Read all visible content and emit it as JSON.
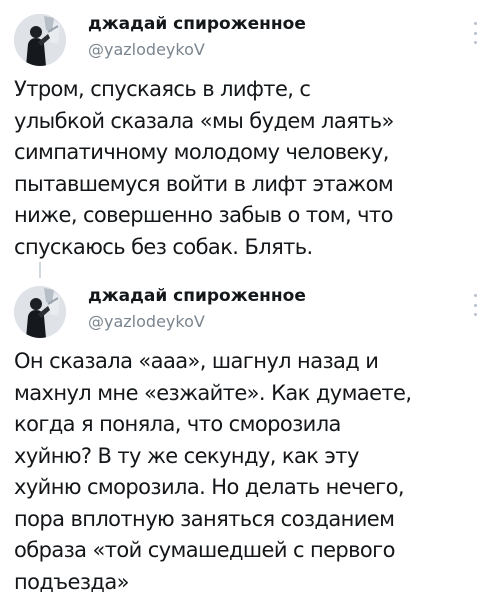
{
  "tweets": [
    {
      "author_name": "джадай спироженное",
      "author_handle": "@yazlodeykoV",
      "avatar_icon": "user-avatar",
      "more_icon": "vertical-dots-icon",
      "text": "Утром, спускаясь в лифте, с\nулыбкой сказала «мы будем лаять»\nсимпатичному молодому человеку,\nпытавшемуся войти в лифт этажом\nниже, совершенно забыв о том, что\nспускаюсь без собак. Блять."
    },
    {
      "author_name": "джадай спироженное",
      "author_handle": "@yazlodeykoV",
      "avatar_icon": "user-avatar",
      "more_icon": "vertical-dots-icon",
      "text": "Он сказала «ааа», шагнул назад и\nмахнул мне «езжайте». Как думаете,\nкогда я поняла, что сморозила\nхуйню? В ту же секунду, как эту\nхуйню сморозила. Но делать нечего,\nпора вплотную заняться созданием\nобраза «той сумашедшей с первого\nподъезда»"
    }
  ],
  "colors": {
    "text": "#14171a",
    "handle": "#7a858f",
    "thread_line": "#cfd9de",
    "background": "#ffffff"
  }
}
